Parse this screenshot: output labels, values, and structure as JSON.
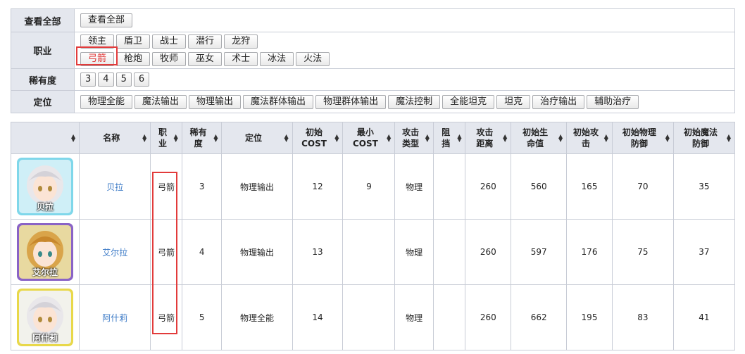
{
  "filter": {
    "all_label": "查看全部",
    "all_button": "查看全部",
    "job_label": "职业",
    "job_options_row1": [
      "领主",
      "盾卫",
      "战士",
      "潜行",
      "龙狩"
    ],
    "job_options_row2": [
      "弓箭",
      "枪炮",
      "牧师",
      "巫女",
      "术士",
      "冰法",
      "火法"
    ],
    "job_selected": "弓箭",
    "rarity_label": "稀有度",
    "rarity_options": [
      "3",
      "4",
      "5",
      "6"
    ],
    "position_label": "定位",
    "position_options": [
      "物理全能",
      "魔法输出",
      "物理输出",
      "魔法群体输出",
      "物理群体输出",
      "魔法控制",
      "全能坦克",
      "坦克",
      "治疗输出",
      "辅助治疗"
    ]
  },
  "table": {
    "headers": [
      "",
      "名称",
      "职业",
      "稀有度",
      "定位",
      "初始 COST",
      "最小 COST",
      "攻击类型",
      "阻挡",
      "攻击距离",
      "初始生命值",
      "初始攻击",
      "初始物理防御",
      "初始魔法防御"
    ],
    "header_lines": [
      [
        ""
      ],
      [
        "名称"
      ],
      [
        "职",
        "业"
      ],
      [
        "稀有",
        "度"
      ],
      [
        "定位"
      ],
      [
        "初始",
        "COST"
      ],
      [
        "最小",
        "COST"
      ],
      [
        "攻击",
        "类型"
      ],
      [
        "阻",
        "挡"
      ],
      [
        "攻击",
        "距离"
      ],
      [
        "初始生",
        "命值"
      ],
      [
        "初始攻",
        "击"
      ],
      [
        "初始物理",
        "防御"
      ],
      [
        "初始魔法",
        "防御"
      ]
    ],
    "rows": [
      {
        "avatar_name": "贝拉",
        "name": "贝拉",
        "job": "弓箭",
        "rarity": "3",
        "position": "物理输出",
        "init_cost": "12",
        "min_cost": "9",
        "atk_type": "物理",
        "block": "",
        "range": "260",
        "hp": "560",
        "atk": "165",
        "pdef": "70",
        "mdef": "35",
        "frame_color": "#7fd7ea",
        "bg_color": "#cfeff7"
      },
      {
        "avatar_name": "艾尔拉",
        "name": "艾尔拉",
        "job": "弓箭",
        "rarity": "4",
        "position": "物理输出",
        "init_cost": "13",
        "min_cost": "",
        "atk_type": "物理",
        "block": "",
        "range": "260",
        "hp": "597",
        "atk": "176",
        "pdef": "75",
        "mdef": "37",
        "frame_color": "#8a63c6",
        "bg_color": "#e8d9a0"
      },
      {
        "avatar_name": "阿什莉",
        "name": "阿什莉",
        "job": "弓箭",
        "rarity": "5",
        "position": "物理全能",
        "init_cost": "14",
        "min_cost": "",
        "atk_type": "物理",
        "block": "",
        "range": "260",
        "hp": "662",
        "atk": "195",
        "pdef": "83",
        "mdef": "41",
        "frame_color": "#e8d84a",
        "bg_color": "#f2f2ec"
      }
    ]
  },
  "colors": {
    "header_bg": "#e4e7ee",
    "border": "#c8ccd6",
    "link": "#3a79c6",
    "highlight": "#e23b3b"
  }
}
